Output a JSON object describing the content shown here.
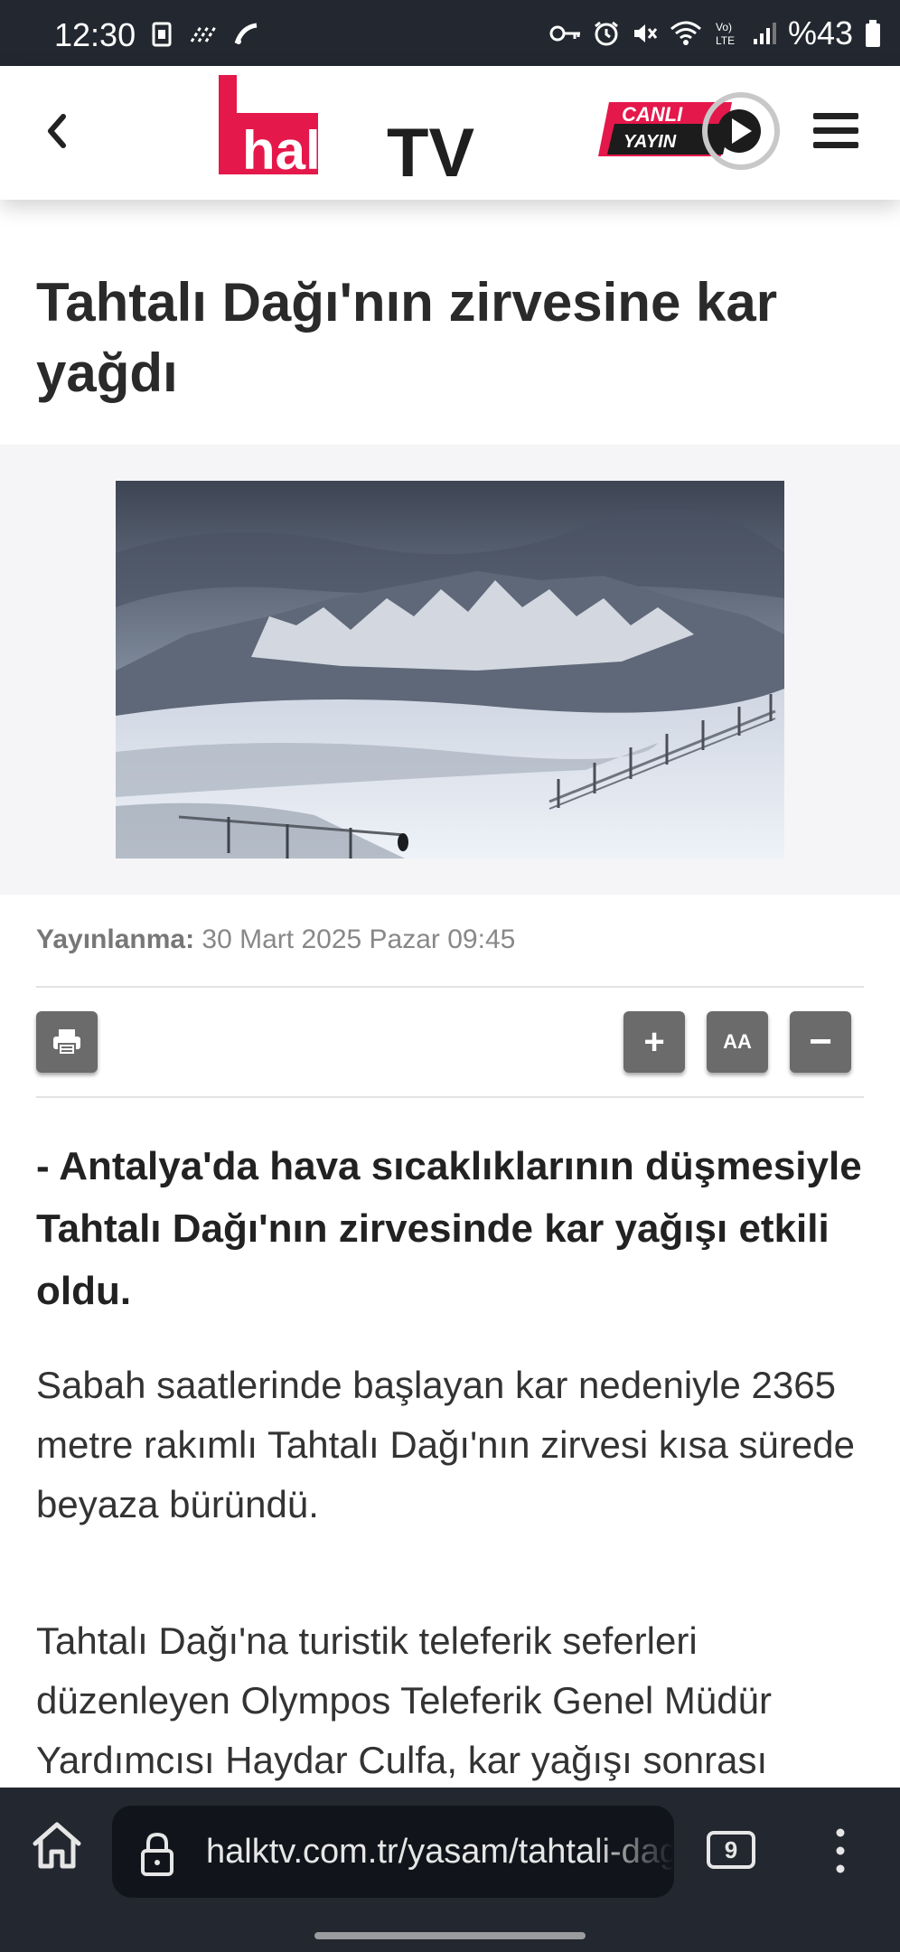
{
  "status_bar": {
    "time": "12:30",
    "battery": "%43",
    "icons": [
      "sim-icon",
      "nfc-icon",
      "cast-icon",
      "key-icon",
      "alarm-icon",
      "mute-icon",
      "wifi-icon",
      "volte-icon",
      "signal-icon",
      "battery-icon"
    ]
  },
  "header": {
    "logo_text_halk": "halk",
    "logo_text_tv": "TV",
    "live_line1": "CANLI",
    "live_line2": "YAYIN"
  },
  "article": {
    "title": "Tahtalı Dağı'nın zirvesine kar yağdı",
    "published_label": "Yayınlanma:",
    "published_value": "30 Mart 2025 Pazar 09:45",
    "font_decrease": "−",
    "font_increase": "+",
    "font_size_label": "AA",
    "lead": "- Antalya'da hava sıcaklıklarının düşmesiyle Tahtalı Dağı'nın zirvesinde kar yağışı etkili oldu.",
    "paragraphs": [
      "Sabah saatlerinde başlayan kar nedeniyle 2365 metre rakımlı Tahtalı Dağı'nın zirvesi kısa sürede beyaza büründü.",
      "Tahtalı Dağı'na turistik teleferik seferleri düzenleyen Olympos Teleferik Genel Müdür Yardımcısı Haydar Culfa, kar yağışı sonrası"
    ]
  },
  "browser": {
    "url": "halktv.com.tr/yasam/tahtali-dagi",
    "tab_count": "9"
  },
  "colors": {
    "brand_pink": "#e5184b",
    "dark_text": "#2a2a2a",
    "toolbar_button": "#6b6b6b",
    "bar_bg": "#23272f"
  }
}
